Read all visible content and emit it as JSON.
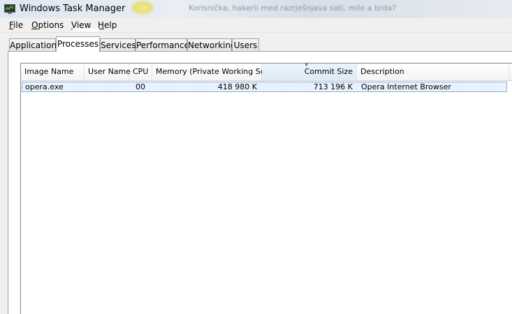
{
  "window": {
    "title": "Windows Task Manager",
    "background_text": "Korisnička, hakerii med razrješnjava sati, mile a brda?"
  },
  "menu": {
    "file": {
      "accel": "F",
      "rest": "ile"
    },
    "options": {
      "accel": "O",
      "rest": "ptions"
    },
    "view": {
      "accel": "V",
      "rest": "iew"
    },
    "help": {
      "accel": "H",
      "rest": "elp"
    }
  },
  "tabs": [
    {
      "label": "Applications",
      "active": false
    },
    {
      "label": "Processes",
      "active": true
    },
    {
      "label": "Services",
      "active": false
    },
    {
      "label": "Performance",
      "active": false
    },
    {
      "label": "Networking",
      "active": false
    },
    {
      "label": "Users",
      "active": false
    }
  ],
  "columns": [
    {
      "label": "Image Name"
    },
    {
      "label": "User Name"
    },
    {
      "label": "CPU"
    },
    {
      "label": "Memory (Private Working Set)"
    },
    {
      "label": "Commit Size",
      "sorted": "descending"
    },
    {
      "label": "Description"
    }
  ],
  "rows": [
    {
      "image_name": "opera.exe",
      "user_name": "",
      "cpu": "00",
      "memory": "418 980 K",
      "commit_size": "713 196 K",
      "description": "Opera Internet Browser",
      "selected": true
    }
  ],
  "colors": {
    "selection_fill": "#e8f2fc",
    "selection_border": "#3a6ea5",
    "chrome": "#f0f0f0"
  }
}
